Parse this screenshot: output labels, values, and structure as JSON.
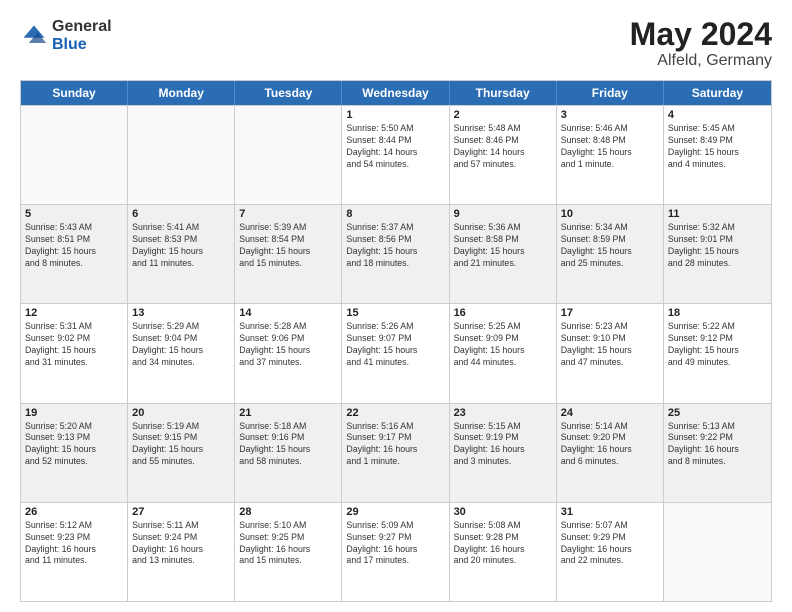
{
  "logo": {
    "general": "General",
    "blue": "Blue"
  },
  "title": {
    "month": "May 2024",
    "location": "Alfeld, Germany"
  },
  "header_days": [
    "Sunday",
    "Monday",
    "Tuesday",
    "Wednesday",
    "Thursday",
    "Friday",
    "Saturday"
  ],
  "weeks": [
    [
      {
        "day": "",
        "lines": []
      },
      {
        "day": "",
        "lines": []
      },
      {
        "day": "",
        "lines": []
      },
      {
        "day": "1",
        "lines": [
          "Sunrise: 5:50 AM",
          "Sunset: 8:44 PM",
          "Daylight: 14 hours",
          "and 54 minutes."
        ]
      },
      {
        "day": "2",
        "lines": [
          "Sunrise: 5:48 AM",
          "Sunset: 8:46 PM",
          "Daylight: 14 hours",
          "and 57 minutes."
        ]
      },
      {
        "day": "3",
        "lines": [
          "Sunrise: 5:46 AM",
          "Sunset: 8:48 PM",
          "Daylight: 15 hours",
          "and 1 minute."
        ]
      },
      {
        "day": "4",
        "lines": [
          "Sunrise: 5:45 AM",
          "Sunset: 8:49 PM",
          "Daylight: 15 hours",
          "and 4 minutes."
        ]
      }
    ],
    [
      {
        "day": "5",
        "lines": [
          "Sunrise: 5:43 AM",
          "Sunset: 8:51 PM",
          "Daylight: 15 hours",
          "and 8 minutes."
        ]
      },
      {
        "day": "6",
        "lines": [
          "Sunrise: 5:41 AM",
          "Sunset: 8:53 PM",
          "Daylight: 15 hours",
          "and 11 minutes."
        ]
      },
      {
        "day": "7",
        "lines": [
          "Sunrise: 5:39 AM",
          "Sunset: 8:54 PM",
          "Daylight: 15 hours",
          "and 15 minutes."
        ]
      },
      {
        "day": "8",
        "lines": [
          "Sunrise: 5:37 AM",
          "Sunset: 8:56 PM",
          "Daylight: 15 hours",
          "and 18 minutes."
        ]
      },
      {
        "day": "9",
        "lines": [
          "Sunrise: 5:36 AM",
          "Sunset: 8:58 PM",
          "Daylight: 15 hours",
          "and 21 minutes."
        ]
      },
      {
        "day": "10",
        "lines": [
          "Sunrise: 5:34 AM",
          "Sunset: 8:59 PM",
          "Daylight: 15 hours",
          "and 25 minutes."
        ]
      },
      {
        "day": "11",
        "lines": [
          "Sunrise: 5:32 AM",
          "Sunset: 9:01 PM",
          "Daylight: 15 hours",
          "and 28 minutes."
        ]
      }
    ],
    [
      {
        "day": "12",
        "lines": [
          "Sunrise: 5:31 AM",
          "Sunset: 9:02 PM",
          "Daylight: 15 hours",
          "and 31 minutes."
        ]
      },
      {
        "day": "13",
        "lines": [
          "Sunrise: 5:29 AM",
          "Sunset: 9:04 PM",
          "Daylight: 15 hours",
          "and 34 minutes."
        ]
      },
      {
        "day": "14",
        "lines": [
          "Sunrise: 5:28 AM",
          "Sunset: 9:06 PM",
          "Daylight: 15 hours",
          "and 37 minutes."
        ]
      },
      {
        "day": "15",
        "lines": [
          "Sunrise: 5:26 AM",
          "Sunset: 9:07 PM",
          "Daylight: 15 hours",
          "and 41 minutes."
        ]
      },
      {
        "day": "16",
        "lines": [
          "Sunrise: 5:25 AM",
          "Sunset: 9:09 PM",
          "Daylight: 15 hours",
          "and 44 minutes."
        ]
      },
      {
        "day": "17",
        "lines": [
          "Sunrise: 5:23 AM",
          "Sunset: 9:10 PM",
          "Daylight: 15 hours",
          "and 47 minutes."
        ]
      },
      {
        "day": "18",
        "lines": [
          "Sunrise: 5:22 AM",
          "Sunset: 9:12 PM",
          "Daylight: 15 hours",
          "and 49 minutes."
        ]
      }
    ],
    [
      {
        "day": "19",
        "lines": [
          "Sunrise: 5:20 AM",
          "Sunset: 9:13 PM",
          "Daylight: 15 hours",
          "and 52 minutes."
        ]
      },
      {
        "day": "20",
        "lines": [
          "Sunrise: 5:19 AM",
          "Sunset: 9:15 PM",
          "Daylight: 15 hours",
          "and 55 minutes."
        ]
      },
      {
        "day": "21",
        "lines": [
          "Sunrise: 5:18 AM",
          "Sunset: 9:16 PM",
          "Daylight: 15 hours",
          "and 58 minutes."
        ]
      },
      {
        "day": "22",
        "lines": [
          "Sunrise: 5:16 AM",
          "Sunset: 9:17 PM",
          "Daylight: 16 hours",
          "and 1 minute."
        ]
      },
      {
        "day": "23",
        "lines": [
          "Sunrise: 5:15 AM",
          "Sunset: 9:19 PM",
          "Daylight: 16 hours",
          "and 3 minutes."
        ]
      },
      {
        "day": "24",
        "lines": [
          "Sunrise: 5:14 AM",
          "Sunset: 9:20 PM",
          "Daylight: 16 hours",
          "and 6 minutes."
        ]
      },
      {
        "day": "25",
        "lines": [
          "Sunrise: 5:13 AM",
          "Sunset: 9:22 PM",
          "Daylight: 16 hours",
          "and 8 minutes."
        ]
      }
    ],
    [
      {
        "day": "26",
        "lines": [
          "Sunrise: 5:12 AM",
          "Sunset: 9:23 PM",
          "Daylight: 16 hours",
          "and 11 minutes."
        ]
      },
      {
        "day": "27",
        "lines": [
          "Sunrise: 5:11 AM",
          "Sunset: 9:24 PM",
          "Daylight: 16 hours",
          "and 13 minutes."
        ]
      },
      {
        "day": "28",
        "lines": [
          "Sunrise: 5:10 AM",
          "Sunset: 9:25 PM",
          "Daylight: 16 hours",
          "and 15 minutes."
        ]
      },
      {
        "day": "29",
        "lines": [
          "Sunrise: 5:09 AM",
          "Sunset: 9:27 PM",
          "Daylight: 16 hours",
          "and 17 minutes."
        ]
      },
      {
        "day": "30",
        "lines": [
          "Sunrise: 5:08 AM",
          "Sunset: 9:28 PM",
          "Daylight: 16 hours",
          "and 20 minutes."
        ]
      },
      {
        "day": "31",
        "lines": [
          "Sunrise: 5:07 AM",
          "Sunset: 9:29 PM",
          "Daylight: 16 hours",
          "and 22 minutes."
        ]
      },
      {
        "day": "",
        "lines": []
      }
    ]
  ]
}
